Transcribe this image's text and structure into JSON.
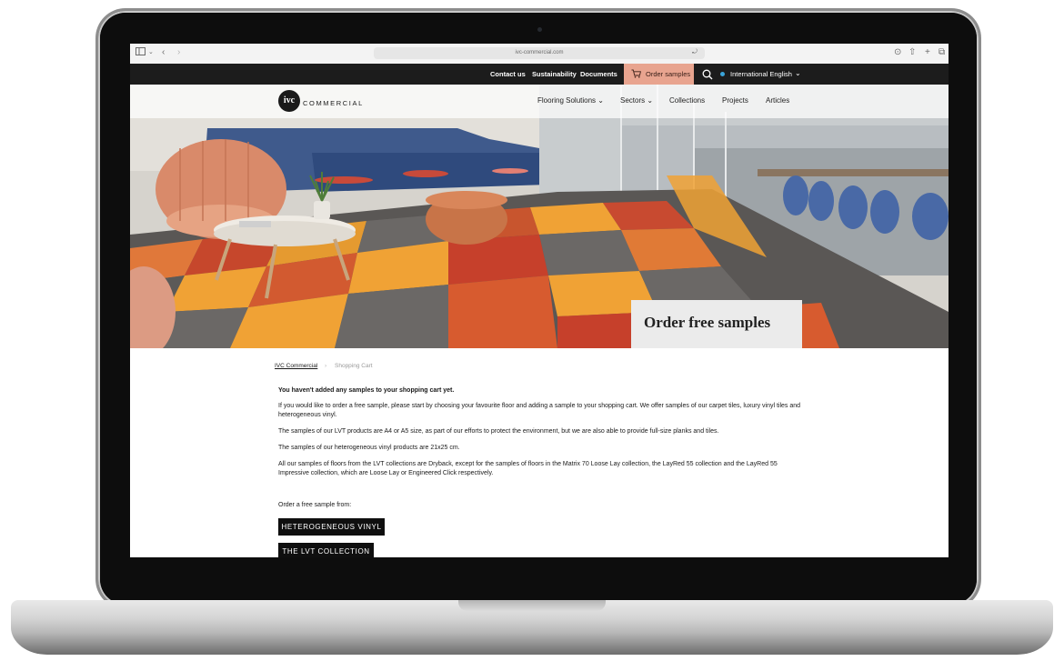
{
  "browser": {
    "url": "ivc-commercial.com"
  },
  "topnav": {
    "links": [
      "Contact us",
      "Sustainability",
      "Documents"
    ],
    "order_samples": "Order samples",
    "language": "International English"
  },
  "brand": {
    "logo_mark": "ivc",
    "logo_text": "COMMERCIAL"
  },
  "mainnav": {
    "items": [
      "Flooring Solutions",
      "Sectors",
      "Collections",
      "Projects",
      "Articles"
    ]
  },
  "hero": {
    "cta": "Order free samples"
  },
  "breadcrumb": {
    "home": "IVC Commercial",
    "sep": "›",
    "current": "Shopping Cart"
  },
  "content": {
    "heading": "You haven't added any samples to your shopping cart yet.",
    "p1": "If you would like to order a free sample, please start by choosing your favourite floor and adding a sample to your shopping cart. We offer samples of our carpet tiles, luxury vinyl tiles and heterogeneous vinyl.",
    "p2": "The samples of our LVT products are A4 or A5 size, as part of our efforts to protect the environment, but we are also able to provide full-size planks and tiles.",
    "p3": "The samples of our heterogeneous vinyl products are 21x25 cm.",
    "p4": "All our samples of floors from the LVT collections are Dryback, except for the samples of floors in the Matrix 70 Loose Lay collection, the LayRed 55 collection and the LayRed 55 Impressive collection, which are Loose Lay or Engineered Click respectively.",
    "order_label": "Order a free sample from:",
    "btn1": "HETEROGENEOUS VINYL",
    "btn2": "THE LVT COLLECTION"
  },
  "colors": {
    "accent": "#e8a48f",
    "dark": "#1c1c1c"
  }
}
